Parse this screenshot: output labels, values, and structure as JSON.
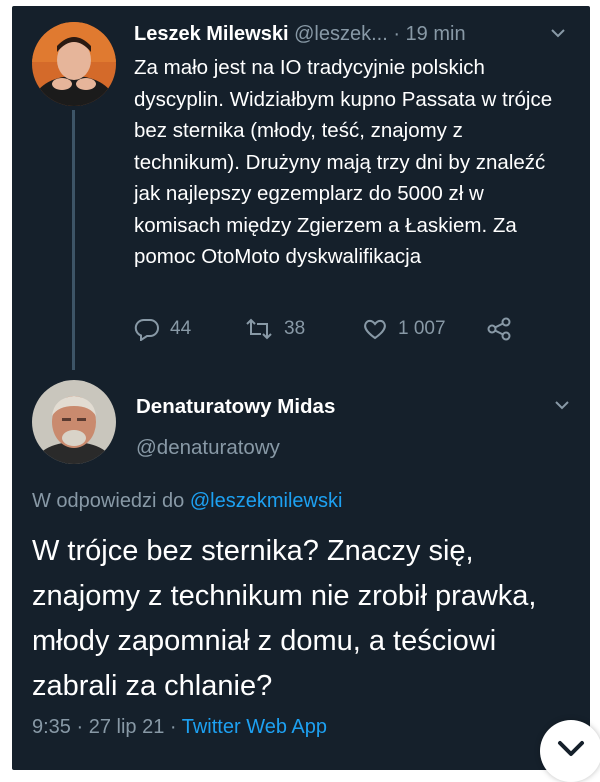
{
  "tweet1": {
    "author_name": "Leszek Milewski",
    "handle": "@leszek...",
    "time": "· 19 min",
    "text": "Za mało jest na IO tradycyjnie polskich dyscyplin. Widziałbym kupno Passata w trójce bez sternika (młody, teść, znajomy z technikum). Drużyny mają trzy dni by znaleźć jak najlepszy egzemplarz do 5000 zł w komisach między Zgierzem a Łaskiem. Za pomoc OtoMoto dyskwalifikacja",
    "replies": "44",
    "retweets": "38",
    "likes": "1 007",
    "icons": [
      "reply-icon",
      "retweet-icon",
      "like-icon",
      "share-icon",
      "chevron-down-icon"
    ]
  },
  "tweet2": {
    "author_name": "Denaturatowy Midas",
    "handle": "@denaturatowy",
    "reply_prefix": "W odpowiedzi do",
    "reply_handle": "@leszekmilewski",
    "text": "W trójce bez sternika? Znaczy się, znajomy z technikum nie zrobił prawka, młody zapomniał z domu, a teściowi zabrali za chlanie?",
    "timestamp": "9:35 · 27 lip 21 ·",
    "source_app": "Twitter Web App"
  },
  "colors": {
    "background": "#15202b",
    "text": "#ffffff",
    "muted": "#8899a6",
    "accent": "#1da1f2",
    "thread_line": "#3d5466"
  }
}
